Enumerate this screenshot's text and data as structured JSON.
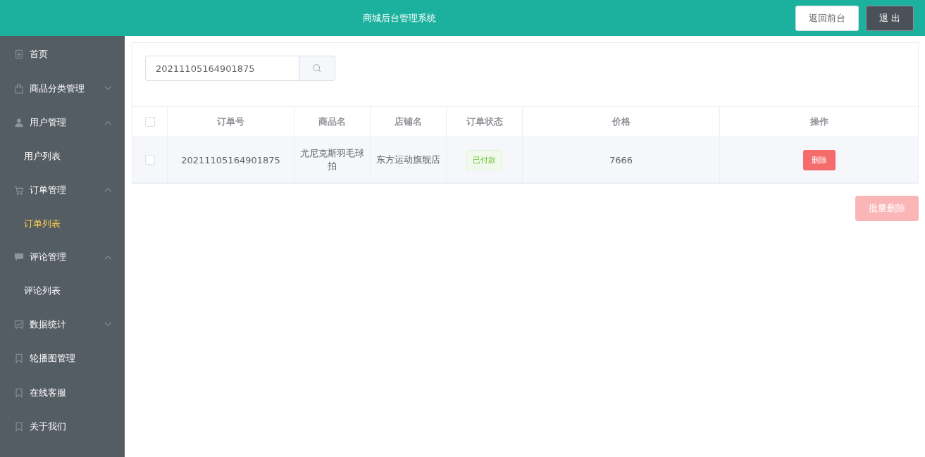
{
  "header": {
    "title": "商城后台管理系统",
    "buttons": [
      {
        "label": "返回前台",
        "kind": "light"
      },
      {
        "label": "退 出",
        "kind": "dark"
      }
    ]
  },
  "sidebar": {
    "items": [
      {
        "label": "首页"
      },
      {
        "label": "商品分类管理",
        "expanded": false
      },
      {
        "label": "用户管理",
        "expanded": true,
        "children": [
          {
            "label": "用户列表",
            "selected": false
          }
        ]
      },
      {
        "label": "订单管理",
        "expanded": true,
        "children": [
          {
            "label": "订单列表",
            "selected": true
          }
        ]
      },
      {
        "label": "评论管理",
        "expanded": true,
        "children": [
          {
            "label": "评论列表",
            "selected": false
          }
        ]
      },
      {
        "label": "数据统计",
        "expanded": false
      },
      {
        "label": "轮播图管理"
      },
      {
        "label": "在线客服"
      },
      {
        "label": "关于我们"
      }
    ]
  },
  "search": {
    "value": "20211105164901875"
  },
  "table": {
    "columns": [
      "订单号",
      "商品名",
      "店铺名",
      "订单状态",
      "价格",
      "操作"
    ],
    "all_checked": false,
    "rows": [
      {
        "checked": false,
        "order_no": "20211105164901875",
        "product": "尤尼克斯羽毛球拍",
        "shop": "东方运动旗舰店",
        "status": "已付款",
        "price": "7666",
        "action": "删除"
      }
    ]
  },
  "batch_delete": {
    "label": "批量删除",
    "disabled": true
  }
}
